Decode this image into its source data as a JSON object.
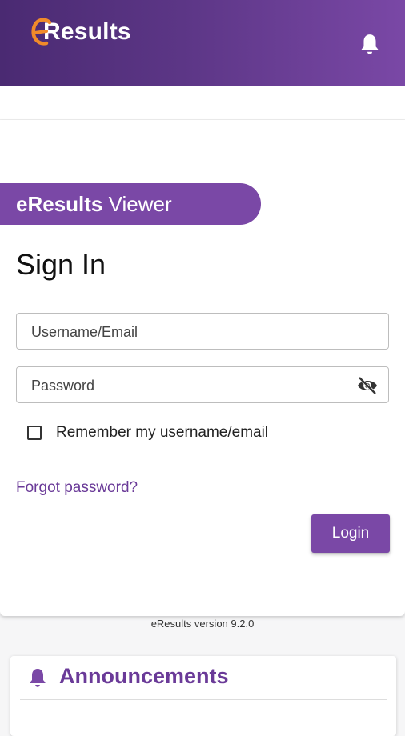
{
  "appbar": {
    "logo_text": "Results",
    "logo_mark": "e",
    "notifications_icon": "bell-icon"
  },
  "colors": {
    "brand_purple": "#7a48a6",
    "brand_orange": "#f08a2a",
    "link_purple": "#6a3a98"
  },
  "login": {
    "banner_bold": "eResults",
    "banner_rest": " Viewer",
    "heading": "Sign In",
    "username_placeholder": "Username/Email",
    "password_placeholder": "Password",
    "password_toggle_icon": "eye-off-icon",
    "remember_label": "Remember my username/email",
    "forgot_link": "Forgot password?",
    "login_button": "Login"
  },
  "footer": {
    "version": "eResults version 9.2.0"
  },
  "announcements": {
    "icon": "bell-icon",
    "title": "Announcements"
  }
}
